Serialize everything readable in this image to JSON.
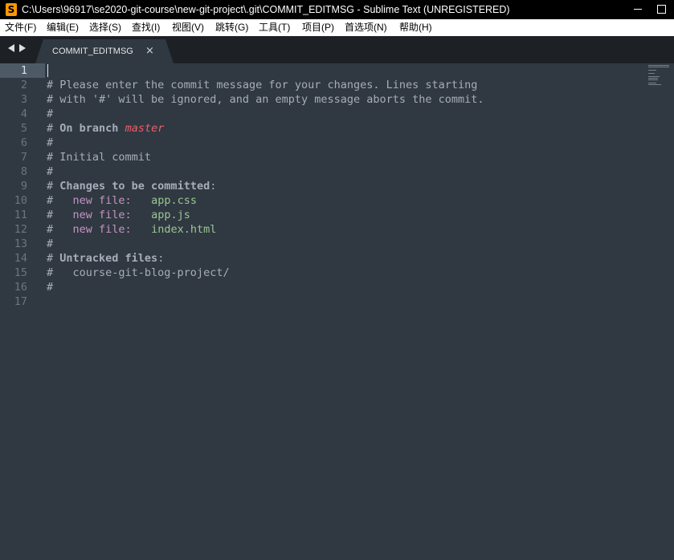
{
  "window": {
    "title": "C:\\Users\\96917\\se2020-git-course\\new-git-project\\.git\\COMMIT_EDITMSG - Sublime Text (UNREGISTERED)",
    "app_icon_glyph": "S"
  },
  "menu": [
    {
      "label": "文件(F)"
    },
    {
      "label": "编辑(E)"
    },
    {
      "label": "选择(S)"
    },
    {
      "label": "查找(I)"
    },
    {
      "label": "视图(V)"
    },
    {
      "label": "跳转(G)"
    },
    {
      "label": "工具(T)"
    },
    {
      "label": "项目(P)"
    },
    {
      "label": "首选项(N)"
    },
    {
      "label": "帮助(H)"
    }
  ],
  "tab": {
    "label": "COMMIT_EDITMSG",
    "close_glyph": "×"
  },
  "editor": {
    "line_numbers": [
      "1",
      "2",
      "3",
      "4",
      "5",
      "6",
      "7",
      "8",
      "9",
      "10",
      "11",
      "12",
      "13",
      "14",
      "15",
      "16",
      "17"
    ],
    "current_line": "1",
    "lines": {
      "l2": "# Please enter the commit message for your changes. Lines starting",
      "l3": "# with '#' will be ignored, and an empty message aborts the commit.",
      "l4": "#",
      "l5_prefix": "# ",
      "l5_kw": "On branch",
      "l5_branch": "master",
      "l6": "#",
      "l7": "# Initial commit",
      "l8": "#",
      "l9_prefix": "# ",
      "l9_kw": "Changes to be committed",
      "l9_suffix": ":",
      "l10_prefix": "#   ",
      "l10_status": "new file:",
      "l10_gap": "   ",
      "l10_file": "app.css",
      "l11_prefix": "#   ",
      "l11_status": "new file:",
      "l11_gap": "   ",
      "l11_file": "app.js",
      "l12_prefix": "#   ",
      "l12_status": "new file:",
      "l12_gap": "   ",
      "l12_file": "index.html",
      "l13": "#",
      "l14_prefix": "# ",
      "l14_kw": "Untracked files",
      "l14_suffix": ":",
      "l15": "#   course-git-blog-project/",
      "l16": "#"
    }
  },
  "colors": {
    "background": "#303841",
    "gutter_active": "#4d5a66",
    "comment": "#a7adba",
    "branch": "#ec5f67",
    "status": "#c594c5",
    "file": "#99c794"
  }
}
